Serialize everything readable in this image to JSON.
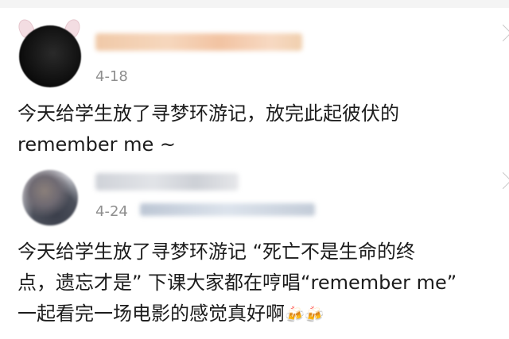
{
  "posts": [
    {
      "date": "4-18",
      "line1": "今天给学生放了寻梦环游记，放完此起彼伏的",
      "line2": "remember me ~"
    },
    {
      "date": "4-24",
      "line1": "今天给学生放了寻梦环游记 “死亡不是生命的终",
      "line2": "点，遗忘才是” 下课大家都在哼唱“remember me”",
      "line3": "一起看完一场电影的感觉真好啊",
      "emoji": "🍻🍻"
    }
  ]
}
